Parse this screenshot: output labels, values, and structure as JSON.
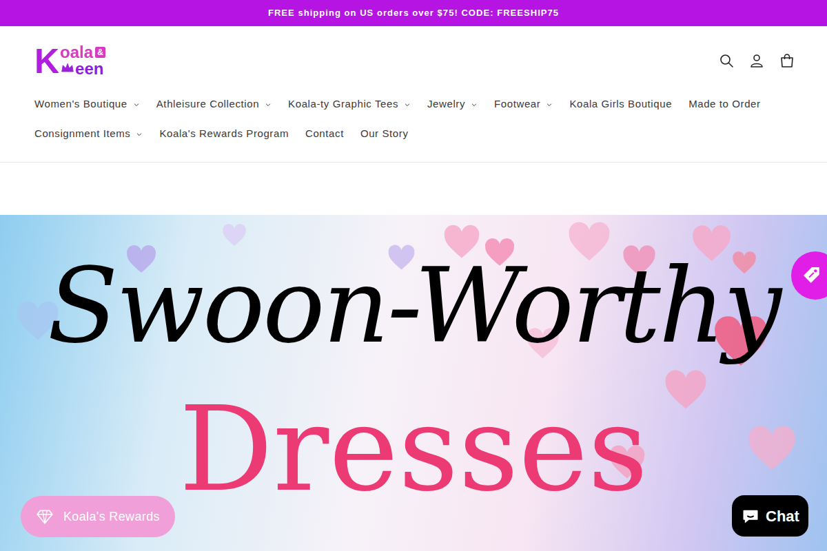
{
  "announcement": "FREE shipping on US orders over $75! CODE: FREESHIP75",
  "logo": {
    "initial": "K",
    "top": "oala",
    "badge": "&",
    "bottom": "een"
  },
  "nav_rows": [
    [
      {
        "label": "Women's Boutique",
        "has_menu": true
      },
      {
        "label": "Athleisure Collection",
        "has_menu": true
      },
      {
        "label": "Koala-ty Graphic Tees",
        "has_menu": true
      },
      {
        "label": "Jewelry",
        "has_menu": true
      },
      {
        "label": "Footwear",
        "has_menu": true
      },
      {
        "label": "Koala Girls Boutique",
        "has_menu": false
      },
      {
        "label": "Made to Order",
        "has_menu": false
      }
    ],
    [
      {
        "label": "Consignment Items",
        "has_menu": true
      },
      {
        "label": "Koala's Rewards Program",
        "has_menu": false
      },
      {
        "label": "Contact",
        "has_menu": false
      },
      {
        "label": "Our Story",
        "has_menu": false
      }
    ]
  ],
  "hero": {
    "title": "Swoon-Worthy",
    "subtitle": "Dresses"
  },
  "rewards_button": {
    "label": "Koala's Rewards"
  },
  "chat_button": {
    "label": "Chat"
  }
}
